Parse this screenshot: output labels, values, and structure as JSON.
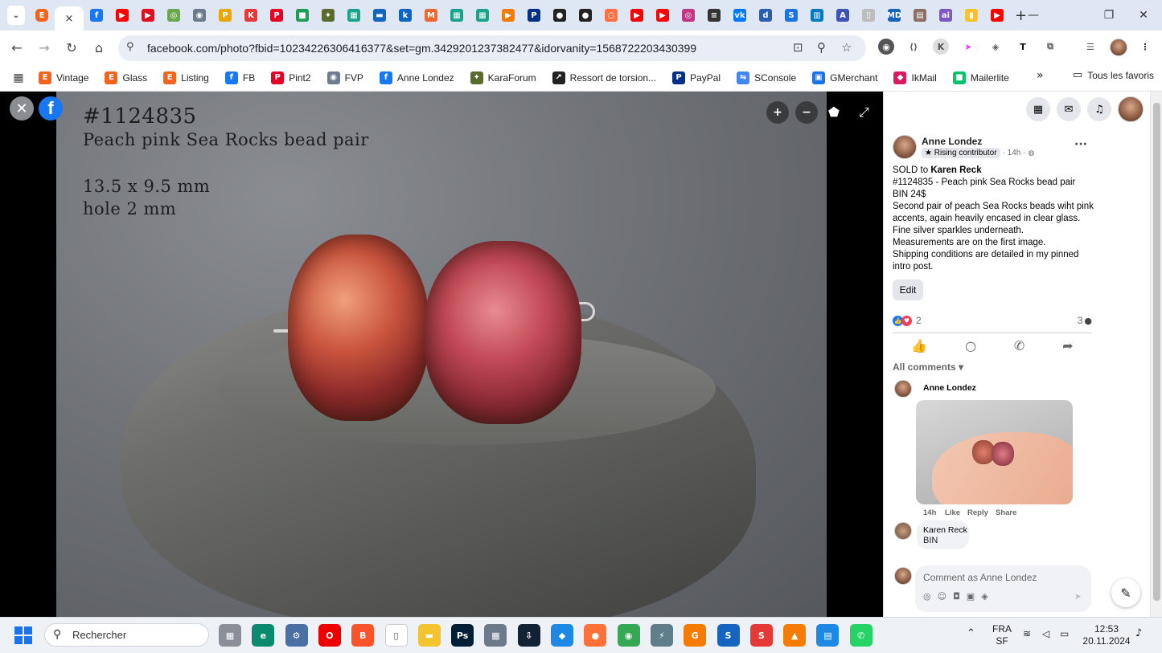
{
  "tabs": {
    "favicons": [
      {
        "name": "etsy",
        "glyph": "E",
        "color": "#f1641e"
      },
      {
        "name": "facebook",
        "glyph": "f",
        "color": "#1877f2"
      },
      {
        "name": "youtube",
        "glyph": "▶",
        "color": "#ff0000"
      },
      {
        "name": "youtube-2",
        "glyph": "▶",
        "color": "#e01020"
      },
      {
        "name": "green-app",
        "glyph": "◎",
        "color": "#6aa84f"
      },
      {
        "name": "settings-app",
        "glyph": "◉",
        "color": "#6d7b8d"
      },
      {
        "name": "pinterest-p",
        "glyph": "P",
        "color": "#e8a800"
      },
      {
        "name": "k-app",
        "glyph": "K",
        "color": "#e53935"
      },
      {
        "name": "pinterest",
        "glyph": "P",
        "color": "#e60023"
      },
      {
        "name": "chat-app",
        "glyph": "■",
        "color": "#1e9e52"
      },
      {
        "name": "karaforum",
        "glyph": "✦",
        "color": "#5b6b2e"
      },
      {
        "name": "grid-app",
        "glyph": "▦",
        "color": "#1aa38a"
      },
      {
        "name": "printer-app",
        "glyph": "▬",
        "color": "#1565c0"
      },
      {
        "name": "k-blue",
        "glyph": "k",
        "color": "#0a66c2"
      },
      {
        "name": "magento",
        "glyph": "M",
        "color": "#ee672f"
      },
      {
        "name": "grid-app-2",
        "glyph": "▦",
        "color": "#1aa38a"
      },
      {
        "name": "grid-app-3",
        "glyph": "▦",
        "color": "#1aa38a"
      },
      {
        "name": "play-orange",
        "glyph": "▶",
        "color": "#f57c00"
      },
      {
        "name": "paypal",
        "glyph": "P",
        "color": "#003087"
      },
      {
        "name": "github",
        "glyph": "●",
        "color": "#222222"
      },
      {
        "name": "github-2",
        "glyph": "●",
        "color": "#222222"
      },
      {
        "name": "circle-orange",
        "glyph": "○",
        "color": "#ff7043"
      },
      {
        "name": "youtube-3",
        "glyph": "▶",
        "color": "#ff0000"
      },
      {
        "name": "youtube-4",
        "glyph": "▶",
        "color": "#ff0000"
      },
      {
        "name": "instagram",
        "glyph": "◎",
        "color": "#c13584"
      },
      {
        "name": "app-dark",
        "glyph": "≡",
        "color": "#333333"
      },
      {
        "name": "vk",
        "glyph": "vk",
        "color": "#0077ff"
      },
      {
        "name": "app-d",
        "glyph": "d",
        "color": "#2a5db0"
      },
      {
        "name": "s-app",
        "glyph": "S",
        "color": "#1a73e8"
      },
      {
        "name": "trello",
        "glyph": "▥",
        "color": "#0079bf"
      },
      {
        "name": "a-app",
        "glyph": "A",
        "color": "#3f51b5"
      },
      {
        "name": "doc-app",
        "glyph": "▯",
        "color": "#bdbdbd"
      },
      {
        "name": "md-app",
        "glyph": "MD",
        "color": "#1565c0"
      },
      {
        "name": "shop-app",
        "glyph": "▤",
        "color": "#8d6e63"
      },
      {
        "name": "ai-app",
        "glyph": "ai",
        "color": "#7e57c2"
      },
      {
        "name": "bag-app",
        "glyph": "▮",
        "color": "#fbc02d"
      },
      {
        "name": "youtube-5",
        "glyph": "▶",
        "color": "#ff0000"
      }
    ],
    "active_close": "×",
    "new_tab": "+"
  },
  "window": {
    "minimize": "—",
    "restore": "❐",
    "close": "✕"
  },
  "toolbar": {
    "url": "facebook.com/photo?fbid=10234226306416377&set=gm.3429201237382477&idorvanity=1568722203430399"
  },
  "bookmarks": [
    {
      "label": "Vintage",
      "glyph": "E",
      "color": "#f1641e"
    },
    {
      "label": "Glass",
      "glyph": "E",
      "color": "#f1641e"
    },
    {
      "label": "Listing",
      "glyph": "E",
      "color": "#f1641e"
    },
    {
      "label": "FB",
      "glyph": "f",
      "color": "#1877f2"
    },
    {
      "label": "Pint2",
      "glyph": "P",
      "color": "#e60023"
    },
    {
      "label": "FVP",
      "glyph": "◉",
      "color": "#6d7b8d"
    },
    {
      "label": "Anne Londez",
      "glyph": "f",
      "color": "#1877f2"
    },
    {
      "label": "KaraForum",
      "glyph": "✦",
      "color": "#5b6b2e"
    },
    {
      "label": "Ressort de torsion...",
      "glyph": "↗",
      "color": "#222222"
    },
    {
      "label": "PayPal",
      "glyph": "P",
      "color": "#003087"
    },
    {
      "label": "SConsole",
      "glyph": "⇋",
      "color": "#4285f4"
    },
    {
      "label": "GMerchant",
      "glyph": "▣",
      "color": "#1a73e8"
    },
    {
      "label": "IkMail",
      "glyph": "◆",
      "color": "#d81b60"
    },
    {
      "label": "Mailerlite",
      "glyph": "■",
      "color": "#09c269"
    }
  ],
  "bookmarks_more": "»",
  "bookmarks_all": "Tous les favoris",
  "photo": {
    "line1": "#1124835",
    "line2": "Peach pink Sea Rocks bead pair",
    "line3": "13.5 x 9.5 mm",
    "line4": "hole 2 mm"
  },
  "post": {
    "author": "Anne Londez",
    "badge": "Rising contributor",
    "time": "· 14h ·",
    "line1_prefix": "SOLD to ",
    "line1_name": "Karen Reck",
    "line2": "#1124835 - Peach pink Sea Rocks bead pair",
    "line3": "BIN 24$",
    "line4": "Second pair of peach Sea Rocks beads wiht pink accents, again heavily encased in clear glass. Fine silver sparkles underneath.",
    "line5": "Measurements are on the first image.",
    "line6": "Shipping conditions are detailed in my pinned intro post.",
    "edit": "Edit",
    "reactions_count": "2",
    "comments_count": "3",
    "all_comments": "All comments"
  },
  "comments": [
    {
      "author": "Anne Londez",
      "meta": [
        "14h",
        "Like",
        "Reply",
        "Share"
      ]
    },
    {
      "author": "Karen Reck",
      "text": "BIN"
    }
  ],
  "comment_box": {
    "placeholder": "Comment as Anne Londez"
  },
  "taskbar": {
    "search": "Rechercher",
    "lang1": "FRA",
    "lang2": "SF",
    "time": "12:53",
    "date": "20.11.2024",
    "apps": [
      {
        "name": "file-explorer-gray",
        "glyph": "▦",
        "color": "#8a8f98"
      },
      {
        "name": "edge",
        "glyph": "e",
        "color": "#0c8a6e"
      },
      {
        "name": "settings",
        "glyph": "⚙",
        "color": "#4a6fa5"
      },
      {
        "name": "opera",
        "glyph": "O",
        "color": "#e00"
      },
      {
        "name": "brave",
        "glyph": "B",
        "color": "#fb542b"
      },
      {
        "name": "notepad",
        "glyph": "▯",
        "color": "#ffffff"
      },
      {
        "name": "file-explorer",
        "glyph": "▬",
        "color": "#f4c430"
      },
      {
        "name": "photoshop",
        "glyph": "Ps",
        "color": "#001e36"
      },
      {
        "name": "calculator",
        "glyph": "▦",
        "color": "#6c7a89"
      },
      {
        "name": "downloader",
        "glyph": "⇩",
        "color": "#123"
      },
      {
        "name": "app-blue",
        "glyph": "◆",
        "color": "#1e88e5"
      },
      {
        "name": "firefox",
        "glyph": "●",
        "color": "#ff7139"
      },
      {
        "name": "chrome",
        "glyph": "◉",
        "color": "#34a853"
      },
      {
        "name": "app-lightning",
        "glyph": "⚡",
        "color": "#607d8b"
      },
      {
        "name": "app-orange",
        "glyph": "G",
        "color": "#f57c00"
      },
      {
        "name": "app-s-blue",
        "glyph": "S",
        "color": "#1565c0"
      },
      {
        "name": "app-s-red",
        "glyph": "S",
        "color": "#e53935"
      },
      {
        "name": "vlc",
        "glyph": "▲",
        "color": "#f57c00"
      },
      {
        "name": "doc-blue",
        "glyph": "▤",
        "color": "#1e88e5"
      },
      {
        "name": "whatsapp",
        "glyph": "✆",
        "color": "#25d366"
      }
    ]
  }
}
